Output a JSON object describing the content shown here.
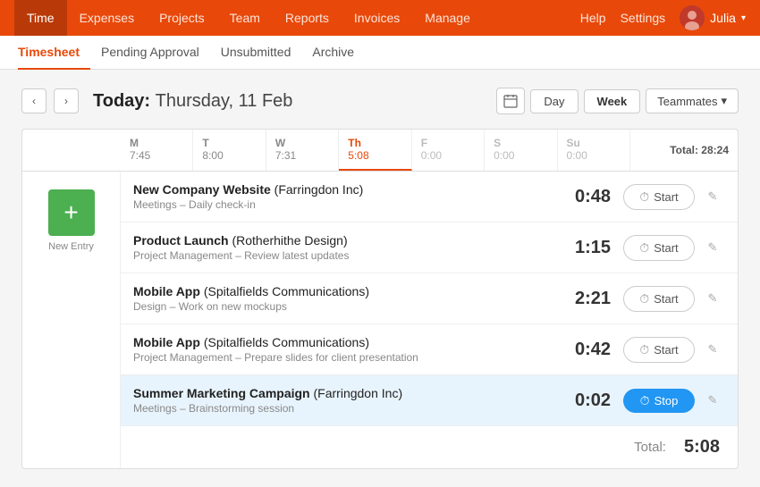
{
  "nav": {
    "items": [
      {
        "id": "time",
        "label": "Time",
        "active": true
      },
      {
        "id": "expenses",
        "label": "Expenses",
        "active": false
      },
      {
        "id": "projects",
        "label": "Projects",
        "active": false
      },
      {
        "id": "team",
        "label": "Team",
        "active": false
      },
      {
        "id": "reports",
        "label": "Reports",
        "active": false
      },
      {
        "id": "invoices",
        "label": "Invoices",
        "active": false
      },
      {
        "id": "manage",
        "label": "Manage",
        "active": false
      }
    ],
    "help": "Help",
    "settings": "Settings",
    "user": "Julia"
  },
  "subnav": {
    "items": [
      {
        "id": "timesheet",
        "label": "Timesheet",
        "active": true
      },
      {
        "id": "pending",
        "label": "Pending Approval",
        "active": false
      },
      {
        "id": "unsubmitted",
        "label": "Unsubmitted",
        "active": false
      },
      {
        "id": "archive",
        "label": "Archive",
        "active": false
      }
    ]
  },
  "header": {
    "today_label": "Today:",
    "date": "Thursday, 11 Feb",
    "prev_arrow": "‹",
    "next_arrow": "›",
    "view_day": "Day",
    "view_week": "Week",
    "teammates": "Teammates"
  },
  "days": [
    {
      "id": "M",
      "name": "M",
      "time": "7:45",
      "active": false,
      "inactive": false
    },
    {
      "id": "T",
      "name": "T",
      "time": "8:00",
      "active": false,
      "inactive": false
    },
    {
      "id": "W",
      "name": "W",
      "time": "7:31",
      "active": false,
      "inactive": false
    },
    {
      "id": "Th",
      "name": "Th",
      "time": "5:08",
      "active": true,
      "inactive": false
    },
    {
      "id": "F",
      "name": "F",
      "time": "0:00",
      "active": false,
      "inactive": true
    },
    {
      "id": "S",
      "name": "S",
      "time": "0:00",
      "active": false,
      "inactive": true
    },
    {
      "id": "Su",
      "name": "Su",
      "time": "0:00",
      "active": false,
      "inactive": true
    }
  ],
  "total_week": "Total: 28:24",
  "new_entry_label": "New Entry",
  "entries": [
    {
      "id": 1,
      "title": "New Company Website",
      "company": "Farringdon Inc",
      "category": "Meetings",
      "description": "Daily check-in",
      "time": "0:48",
      "running": false
    },
    {
      "id": 2,
      "title": "Product Launch",
      "company": "Rotherhithe Design",
      "category": "Project Management",
      "description": "Review latest updates",
      "time": "1:15",
      "running": false
    },
    {
      "id": 3,
      "title": "Mobile App",
      "company": "Spitalfields Communications",
      "category": "Design",
      "description": "Work on new mockups",
      "time": "2:21",
      "running": false
    },
    {
      "id": 4,
      "title": "Mobile App",
      "company": "Spitalfields Communications",
      "category": "Project Management",
      "description": "Prepare slides for client presentation",
      "time": "0:42",
      "running": false
    },
    {
      "id": 5,
      "title": "Summer Marketing Campaign",
      "company": "Farringdon Inc",
      "category": "Meetings",
      "description": "Brainstorming session",
      "time": "0:02",
      "running": true
    }
  ],
  "buttons": {
    "start": "Start",
    "stop": "Stop"
  },
  "total_label": "Total:",
  "total_day": "5:08"
}
